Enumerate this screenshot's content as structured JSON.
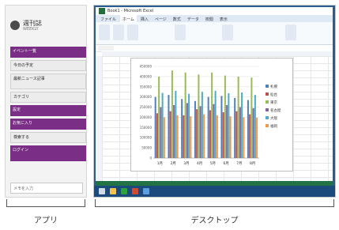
{
  "app_panel": {
    "logo_title": "週刊誌",
    "logo_subtitle": "WEEKLY",
    "items": [
      {
        "label": "イベント一覧",
        "style": "purple"
      },
      {
        "label": "今日の予定",
        "style": "grey"
      },
      {
        "label": "最新ニュース記事",
        "style": "grey tall"
      },
      {
        "label": "カテゴリ",
        "style": "grey"
      },
      {
        "label": "設定",
        "style": "purple"
      },
      {
        "label": "お気に入り",
        "style": "purple"
      },
      {
        "label": "検索する",
        "style": "grey"
      },
      {
        "label": "ログイン",
        "style": "purple tall"
      }
    ],
    "input_placeholder": "メモを入力"
  },
  "excel": {
    "title": "Book1 - Microsoft Excel",
    "tabs": [
      "ファイル",
      "ホーム",
      "挿入",
      "ページ",
      "数式",
      "データ",
      "校閲",
      "表示"
    ]
  },
  "chart_data": {
    "type": "bar",
    "categories": [
      "1月",
      "2月",
      "3月",
      "4月",
      "5月",
      "6月",
      "7月",
      "8月"
    ],
    "series": [
      {
        "name": "札幌",
        "color": "#4f81bd",
        "values": [
          300000,
          310000,
          290000,
          280000,
          300000,
          305000,
          295000,
          285000
        ]
      },
      {
        "name": "仙台",
        "color": "#c0504d",
        "values": [
          220000,
          230000,
          210000,
          240000,
          235000,
          225000,
          230000,
          215000
        ]
      },
      {
        "name": "東京",
        "color": "#9bbb59",
        "values": [
          400000,
          430000,
          420000,
          410000,
          420000,
          405000,
          400000,
          395000
        ]
      },
      {
        "name": "名古屋",
        "color": "#8064a2",
        "values": [
          250000,
          260000,
          270000,
          255000,
          265000,
          260000,
          250000,
          245000
        ]
      },
      {
        "name": "大阪",
        "color": "#4bacc6",
        "values": [
          320000,
          330000,
          315000,
          325000,
          330000,
          318000,
          322000,
          310000
        ]
      },
      {
        "name": "福岡",
        "color": "#f79646",
        "values": [
          200000,
          210000,
          205000,
          215000,
          210000,
          205000,
          200000,
          198000
        ]
      }
    ],
    "ylim": [
      0,
      450000
    ],
    "yticks": [
      0,
      50000,
      100000,
      150000,
      200000,
      250000,
      300000,
      350000,
      400000,
      450000
    ]
  },
  "captions": {
    "app": "アプリ",
    "desktop": "デスクトップ"
  }
}
